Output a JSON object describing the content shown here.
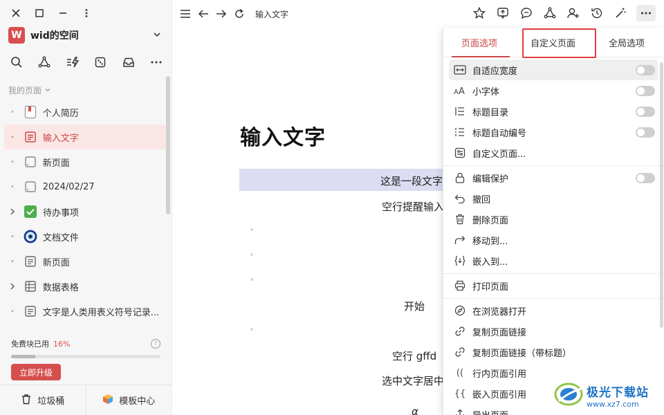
{
  "sidebar": {
    "workspace": {
      "avatar_letter": "W",
      "name": "wid的空间"
    },
    "section_title": "我的页面",
    "pages": [
      {
        "label": "个人简历",
        "icon": "bookmark-doc-icon"
      },
      {
        "label": "输入文字",
        "icon": "document-icon",
        "active": true
      },
      {
        "label": "新页面",
        "icon": "blank-page-icon"
      },
      {
        "label": "2024/02/27",
        "icon": "blank-page-icon"
      },
      {
        "label": "待办事项",
        "icon": "checkbox-icon"
      },
      {
        "label": "文档文件",
        "icon": "eye-icon"
      },
      {
        "label": "新页面",
        "icon": "document-icon"
      },
      {
        "label": "数据表格",
        "icon": "table-icon"
      },
      {
        "label": "文字是人类用表义符号记录...",
        "icon": "document-icon"
      }
    ],
    "quota": {
      "label": "免费块已用",
      "percent_text": "16%",
      "percent": 16,
      "info": "!"
    },
    "upgrade_label": "立即升级",
    "trash_label": "垃圾桶",
    "templates_label": "模板中心"
  },
  "topbar": {
    "title": "输入文字"
  },
  "document": {
    "title": "输入文字",
    "lines": [
      "这是一段文字",
      "空行提醒输入",
      "开始",
      "空行 gffd",
      "选中文字居中"
    ],
    "partial_glyph": "α"
  },
  "menu": {
    "tabs": [
      "页面选项",
      "自定义页面",
      "全局选项"
    ],
    "items_group1": [
      {
        "label": "自适应宽度",
        "icon": "fit-width-icon",
        "toggle": false
      },
      {
        "label": "小字体",
        "icon": "font-size-icon",
        "toggle": false
      },
      {
        "label": "标题目录",
        "icon": "outline-icon",
        "toggle": false
      },
      {
        "label": "标题自动编号",
        "icon": "numbered-list-icon",
        "toggle": false
      },
      {
        "label": "自定义页面...",
        "icon": "customize-icon"
      }
    ],
    "items_group2": [
      {
        "label": "编辑保护",
        "icon": "lock-icon",
        "toggle": false
      },
      {
        "label": "撤回",
        "icon": "undo-icon"
      },
      {
        "label": "删除页面",
        "icon": "trash-icon"
      },
      {
        "label": "移动到...",
        "icon": "move-icon"
      },
      {
        "label": "嵌入到...",
        "icon": "embed-icon"
      }
    ],
    "items_group3": [
      {
        "label": "打印页面",
        "icon": "printer-icon"
      }
    ],
    "items_group4": [
      {
        "label": "在浏览器打开",
        "icon": "compass-icon"
      },
      {
        "label": "复制页面链接",
        "icon": "link-icon"
      },
      {
        "label": "复制页面链接（带标题）",
        "icon": "link-icon"
      },
      {
        "label": "行内页面引用",
        "icon": "inline-ref-icon",
        "glyph": "(("
      },
      {
        "label": "嵌入页面引用",
        "icon": "embed-ref-icon",
        "glyph": "{{"
      },
      {
        "label": "导出页面",
        "icon": "export-icon"
      }
    ]
  },
  "watermark": {
    "name": "极光下载站",
    "url": "www.xz7.com"
  }
}
